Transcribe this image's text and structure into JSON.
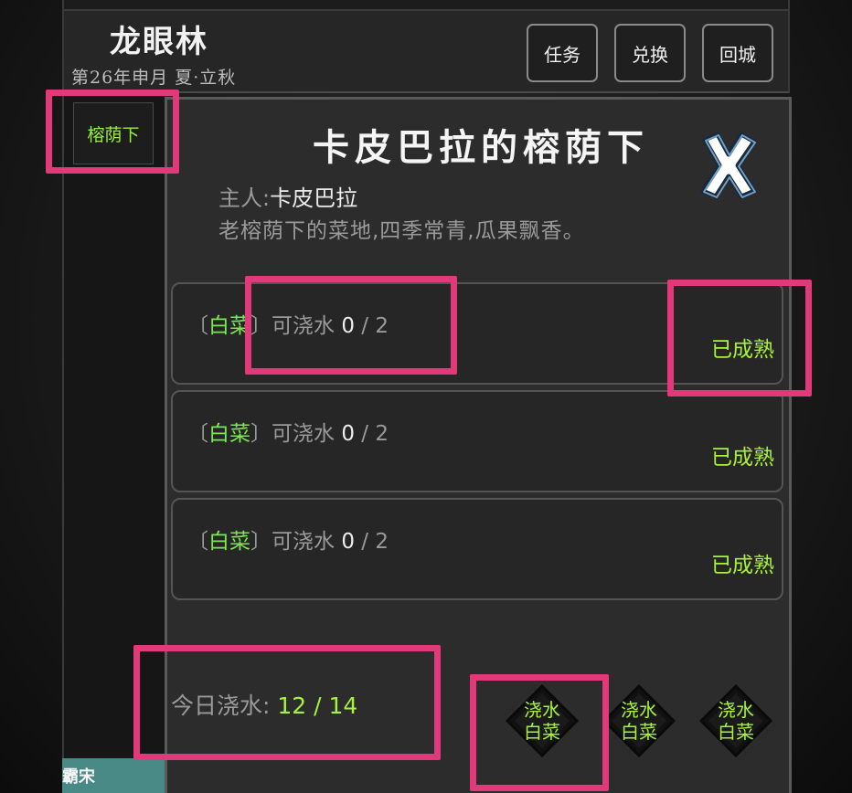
{
  "header": {
    "location": "龙眼林",
    "date": "第26年申月 夏·立秋",
    "buttons": {
      "quest": "任务",
      "exchange": "兑换",
      "return": "回城"
    }
  },
  "sidebar": {
    "tab_label": "榕荫下",
    "footer": "霸宋"
  },
  "panel": {
    "title": "卡皮巴拉的榕荫下",
    "owner_label": "主人:",
    "owner_name": "卡皮巴拉",
    "description": "老榕荫下的菜地,四季常青,瓜果飘香。",
    "plots": [
      {
        "bracket_open": "〔",
        "crop": "白菜",
        "bracket_close": "〕",
        "water_label": "可浇水",
        "watered": "0",
        "sep": " / ",
        "max": "2",
        "status": "已成熟"
      },
      {
        "bracket_open": "〔",
        "crop": "白菜",
        "bracket_close": "〕",
        "water_label": "可浇水",
        "watered": "0",
        "sep": " / ",
        "max": "2",
        "status": "已成熟"
      },
      {
        "bracket_open": "〔",
        "crop": "白菜",
        "bracket_close": "〕",
        "water_label": "可浇水",
        "watered": "0",
        "sep": " / ",
        "max": "2",
        "status": "已成熟"
      }
    ],
    "today_label": "今日浇水:",
    "today_value": "12 / 14",
    "water_buttons": [
      {
        "line1": "浇水",
        "line2": "白菜"
      },
      {
        "line1": "浇水",
        "line2": "白菜"
      },
      {
        "line1": "浇水",
        "line2": "白菜"
      }
    ]
  },
  "colors": {
    "accent_green": "#a8f23a",
    "crop_green": "#7ae84e",
    "highlight": "#e2397a"
  }
}
